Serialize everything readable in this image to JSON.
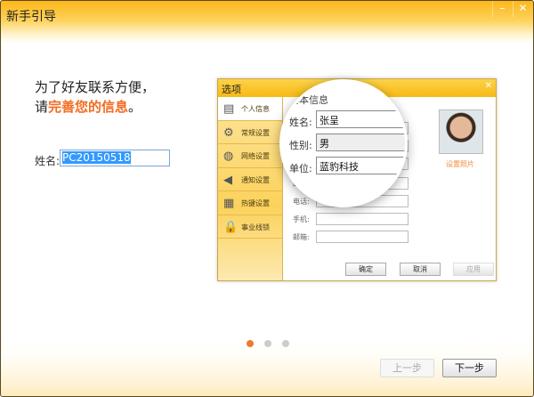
{
  "window": {
    "title": "新手引导",
    "minimize": "–",
    "close": "✕"
  },
  "intro": {
    "line1": "为了好友联系方便，",
    "line2_prefix": "请",
    "line2_highlight": "完善您的信息",
    "line2_suffix": "。",
    "accent": "#f26c22"
  },
  "name_field": {
    "label": "姓名:",
    "value": "PC20150518"
  },
  "illustration": {
    "title": "选项",
    "close": "✕",
    "sidebar": [
      {
        "label": "个人信息",
        "icon": "id-card-icon"
      },
      {
        "label": "常规设置",
        "icon": "gear-icon"
      },
      {
        "label": "网络设置",
        "icon": "globe-icon"
      },
      {
        "label": "通知设置",
        "icon": "speaker-icon"
      },
      {
        "label": "热键设置",
        "icon": "keyboard-icon"
      },
      {
        "label": "事业线锁",
        "icon": "lock-icon"
      }
    ],
    "section": "基本信息",
    "fields": [
      {
        "label": "姓名:",
        "value": "张呈"
      },
      {
        "label": "性别:",
        "value": "男"
      },
      {
        "label": "单位:",
        "value": "蓝豹科技"
      },
      {
        "label": "邮件:"
      },
      {
        "label": "电话:"
      },
      {
        "label": "手机:"
      },
      {
        "label": "邮箱:"
      }
    ],
    "photo_link": "设置照片",
    "buttons": {
      "ok": "确定",
      "cancel": "取消",
      "apply": "应用"
    }
  },
  "pager": {
    "current": 1,
    "total": 3
  },
  "nav": {
    "prev": "上一步",
    "next": "下一步"
  }
}
